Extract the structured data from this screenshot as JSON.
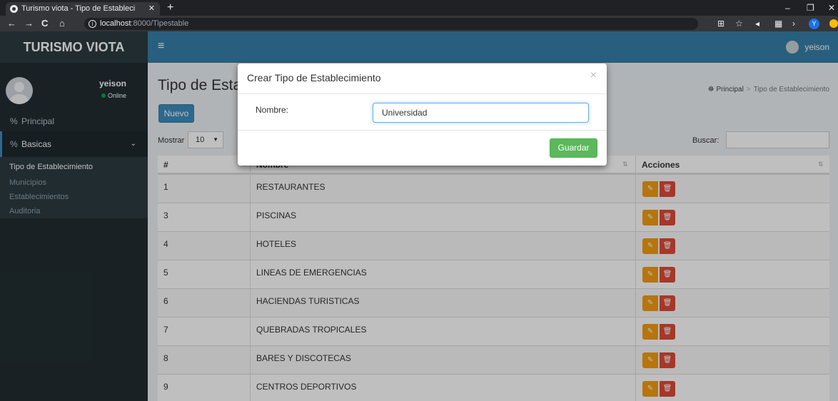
{
  "browser": {
    "tab_title": "Turismo viota - Tipo de Estableci",
    "tab_close": "✕",
    "new_tab": "+",
    "url_host": "localhost",
    "url_path": ":8000/Tipestable",
    "win_min": "–",
    "win_restore": "❐",
    "win_close": "✕",
    "nav_back": "←",
    "nav_forward": "→",
    "nav_reload": "C",
    "nav_home": "⌂",
    "profile_initial": "Y"
  },
  "app": {
    "logo": "TURISMO VIOTA",
    "menu_toggle": "≡",
    "top_user": "yeison"
  },
  "sidebar": {
    "user_name": "yeison",
    "user_status": "Online",
    "items": [
      {
        "label": "Principal",
        "icon": "link-icon"
      },
      {
        "label": "Basicas",
        "icon": "link-icon"
      }
    ],
    "submenu": [
      "Tipo de Establecimiento",
      "Municipios",
      "Establecimientos",
      "Auditoria"
    ]
  },
  "content": {
    "title": "Tipo de Esta",
    "breadcrumb": {
      "home": "Principal",
      "current": "Tipo de Establecimiento"
    },
    "new_button": "Nuevo",
    "length_label": "Mostrar",
    "length_value": "10",
    "search_label": "Buscar:",
    "columns": [
      "#",
      "Nombre",
      "Acciones"
    ],
    "rows": [
      {
        "id": "1",
        "nombre": "RESTAURANTES"
      },
      {
        "id": "3",
        "nombre": "PISCINAS"
      },
      {
        "id": "4",
        "nombre": "HOTELES"
      },
      {
        "id": "5",
        "nombre": "LINEAS DE EMERGENCIAS"
      },
      {
        "id": "6",
        "nombre": "HACIENDAS TURISTICAS"
      },
      {
        "id": "7",
        "nombre": "QUEBRADAS TROPICALES"
      },
      {
        "id": "8",
        "nombre": "BARES Y DISCOTECAS"
      },
      {
        "id": "9",
        "nombre": "CENTROS DEPORTIVOS"
      }
    ]
  },
  "modal": {
    "title": "Crear Tipo de Establecimiento",
    "close": "×",
    "field_label": "Nombre:",
    "field_value": "Universidad",
    "save_button": "Guardar"
  },
  "colors": {
    "header": "#367fa9",
    "logo_bg": "#2c3b41",
    "sidebar_bg": "#222d32",
    "primary": "#3c8dbc",
    "success": "#5cb85c",
    "warning": "#f39c12",
    "danger": "#dd4b39"
  }
}
